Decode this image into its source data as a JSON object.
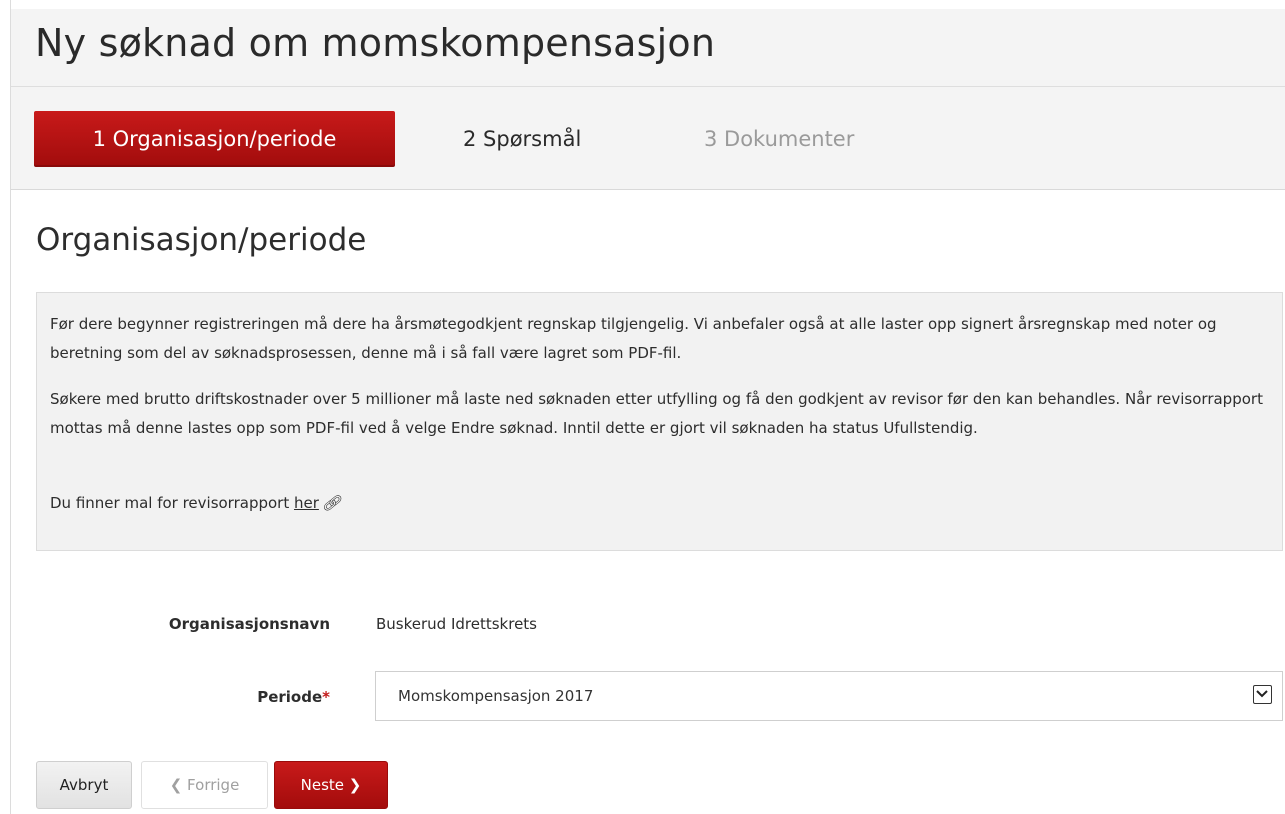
{
  "header": {
    "title": "Ny søknad om momskompensasjon"
  },
  "steps": [
    {
      "label": "1 Organisasjon/periode",
      "state": "active"
    },
    {
      "label": "2 Spørsmål",
      "state": "enabled"
    },
    {
      "label": "3 Dokumenter",
      "state": "disabled"
    }
  ],
  "section": {
    "title": "Organisasjon/periode"
  },
  "info": {
    "paragraph1": "Før dere begynner registreringen må dere ha årsmøtegodkjent regnskap tilgjengelig. Vi anbefaler også at alle laster opp signert årsregnskap med noter og beretning som del av søknadsprosessen, denne må i så fall være lagret som PDF-fil.",
    "paragraph2": "Søkere med brutto driftskostnader over 5 millioner må laste ned søknaden etter utfylling og få den godkjent av revisor før den kan behandles. Når revisorrapport mottas må denne lastes opp som PDF-fil ved å velge Endre søknad. Inntil dette er gjort vil søknaden ha status Ufullstendig.",
    "paragraph3_prefix": "Du finner mal for revisorrapport ",
    "link_text": "her",
    "link_icon": "link-icon"
  },
  "form": {
    "org_label": "Organisasjonsnavn",
    "org_value": "Buskerud Idrettskrets",
    "period_label": "Periode",
    "required_mark": "*",
    "period_value": "Momskompensasjon 2017"
  },
  "buttons": {
    "cancel": "Avbryt",
    "prev": "Forrige",
    "prev_icon": "chevron-left-icon",
    "next": "Neste",
    "next_icon": "chevron-right-icon"
  },
  "colors": {
    "accent": "#b01212",
    "header_bg": "#f4f4f4",
    "info_bg": "#f2f2f2"
  }
}
